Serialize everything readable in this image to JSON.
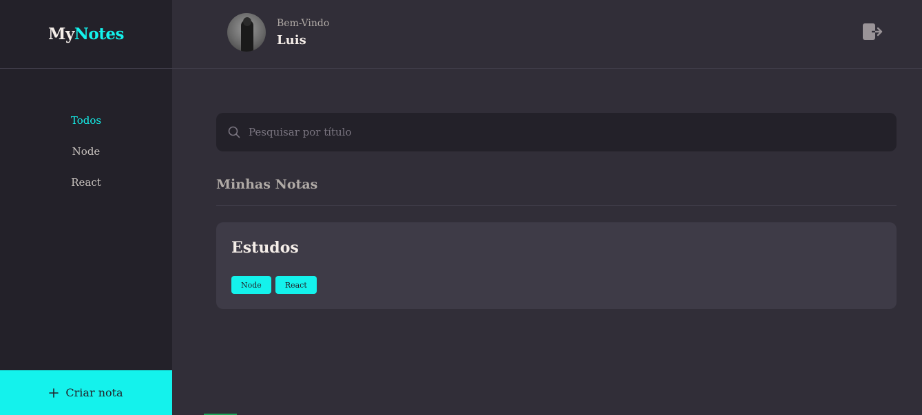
{
  "brand": {
    "part1": "My",
    "part2": "Notes"
  },
  "sidebar": {
    "items": [
      {
        "label": "Todos",
        "active": true
      },
      {
        "label": "Node",
        "active": false
      },
      {
        "label": "React",
        "active": false
      }
    ],
    "new_note_label": "Criar nota"
  },
  "header": {
    "greeting": "Bem-Vindo",
    "username": "Luis",
    "logout_icon": "sign-out-icon"
  },
  "search": {
    "placeholder": "Pesquisar por título",
    "value": ""
  },
  "section": {
    "title": "Minhas Notas"
  },
  "notes": [
    {
      "title": "Estudos",
      "tags": [
        "Node",
        "React"
      ]
    }
  ],
  "colors": {
    "accent": "#14F2EC",
    "background": "#312E38",
    "sidebar": "#232129",
    "card": "#3E3B47"
  }
}
